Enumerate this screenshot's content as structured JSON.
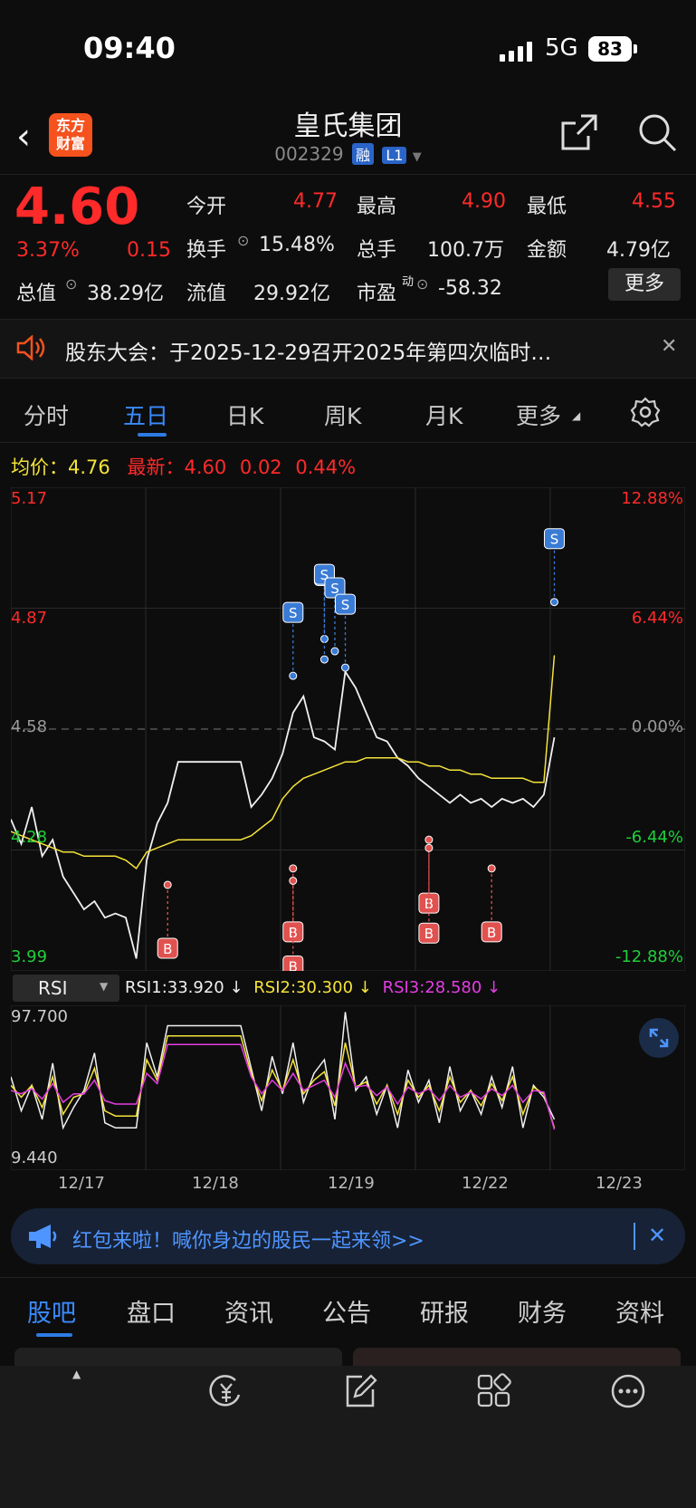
{
  "status_bar": {
    "time": "09:40",
    "network": "5G",
    "battery": "83"
  },
  "header": {
    "logo": "东方\n财富",
    "title": "皇氏集团",
    "code": "002329",
    "tags": [
      "融",
      "L1"
    ]
  },
  "quote": {
    "price": "4.60",
    "change_pct": "3.37%",
    "change_amt": "0.15",
    "fields": [
      {
        "label": "今开",
        "value": "4.77",
        "color": "red"
      },
      {
        "label": "最高",
        "value": "4.90",
        "color": "red"
      },
      {
        "label": "最低",
        "value": "4.55",
        "color": "red"
      },
      {
        "label": "换手",
        "value": "15.48%",
        "color": "white"
      },
      {
        "label": "总手",
        "value": "100.7万",
        "color": "white"
      },
      {
        "label": "金额",
        "value": "4.79亿",
        "color": "white"
      },
      {
        "label": "总值",
        "value": "38.29亿",
        "color": "white"
      },
      {
        "label": "流值",
        "value": "29.92亿",
        "color": "white"
      },
      {
        "label": "市盈",
        "value": "-58.32",
        "color": "white"
      }
    ],
    "pe_sup": "动",
    "more_label": "更多"
  },
  "notice": {
    "text": "股东大会：于2025-12-29召开2025年第四次临时…"
  },
  "period_tabs": [
    "分时",
    "五日",
    "日K",
    "周K",
    "月K",
    "更多"
  ],
  "active_period": "五日",
  "price_header": {
    "avg_label": "均价：",
    "avg_value": "4.76",
    "latest_label": "最新：",
    "latest_value": "4.60",
    "latest_change": "0.02",
    "latest_pct": "0.44%"
  },
  "chart_data": {
    "type": "line",
    "y_left_ticks": [
      "5.17",
      "4.87",
      "4.58",
      "4.28",
      "3.99"
    ],
    "y_right_ticks": [
      "12.88%",
      "6.44%",
      "0.00%",
      "-6.44%",
      "-12.88%"
    ],
    "ylim": [
      3.99,
      5.17
    ],
    "reference_price": 4.58,
    "x_labels": [
      "12/17",
      "12/18",
      "12/19",
      "12/22",
      "12/23"
    ],
    "series": [
      {
        "color": "#f0f0f0",
        "values": [
          4.36,
          4.3,
          4.39,
          4.27,
          4.31,
          4.22,
          4.18,
          4.14,
          4.16,
          4.12,
          4.13,
          4.12,
          4.02,
          4.26,
          4.35,
          4.4,
          4.5,
          4.5,
          4.5,
          4.5,
          4.5,
          4.5,
          4.5,
          4.39,
          4.42,
          4.46,
          4.52,
          4.62,
          4.66,
          4.56,
          4.55,
          4.53,
          4.72,
          4.68,
          4.62,
          4.56,
          4.55,
          4.51,
          4.49,
          4.46,
          4.44,
          4.42,
          4.4,
          4.42,
          4.4,
          4.41,
          4.39,
          4.41,
          4.4,
          4.41,
          4.39,
          4.42,
          4.56
        ]
      },
      {
        "color": "#f5e33a",
        "values": [
          4.33,
          4.32,
          4.31,
          4.3,
          4.29,
          4.28,
          4.28,
          4.27,
          4.27,
          4.27,
          4.27,
          4.26,
          4.24,
          4.28,
          4.29,
          4.3,
          4.31,
          4.31,
          4.31,
          4.31,
          4.31,
          4.31,
          4.31,
          4.32,
          4.34,
          4.36,
          4.41,
          4.44,
          4.46,
          4.47,
          4.48,
          4.49,
          4.5,
          4.5,
          4.51,
          4.51,
          4.51,
          4.51,
          4.5,
          4.5,
          4.49,
          4.49,
          4.48,
          4.48,
          4.47,
          4.47,
          4.46,
          4.46,
          4.46,
          4.46,
          4.45,
          4.45,
          4.76
        ]
      }
    ],
    "markers": [
      {
        "type": "S",
        "x_index": 27,
        "price": 4.71
      },
      {
        "type": "S",
        "x_index": 30,
        "price": 4.8
      },
      {
        "type": "S",
        "x_index": 30,
        "price": 4.75
      },
      {
        "type": "S",
        "x_index": 31,
        "price": 4.77
      },
      {
        "type": "S",
        "x_index": 32,
        "price": 4.73
      },
      {
        "type": "S",
        "x_index": 52,
        "price": 4.89
      },
      {
        "type": "B",
        "x_index": 15,
        "price": 4.2
      },
      {
        "type": "B",
        "x_index": 27,
        "price": 4.24
      },
      {
        "type": "B",
        "x_index": 27,
        "price": 4.21
      },
      {
        "type": "B",
        "x_index": 40,
        "price": 4.31
      },
      {
        "type": "B",
        "x_index": 40,
        "price": 4.29
      },
      {
        "type": "B",
        "x_index": 46,
        "price": 4.24
      }
    ]
  },
  "rsi": {
    "selector": "RSI",
    "rsi1_label": "RSI1:33.920 ↓",
    "rsi2_label": "RSI2:30.300 ↓",
    "rsi3_label": "RSI3:28.580 ↓",
    "top_tick": "97.700",
    "bottom_tick": "9.440",
    "ylim": [
      9.44,
      97.7
    ],
    "series": [
      {
        "name": "RSI1",
        "color": "#f0f0f0",
        "values": [
          60,
          40,
          55,
          35,
          68,
          30,
          42,
          52,
          74,
          33,
          30,
          30,
          30,
          80,
          60,
          90,
          90,
          90,
          90,
          90,
          90,
          90,
          90,
          65,
          40,
          72,
          50,
          80,
          45,
          62,
          70,
          35,
          98,
          52,
          60,
          38,
          55,
          30,
          64,
          45,
          58,
          33,
          66,
          40,
          52,
          38,
          60,
          42,
          66,
          30,
          55,
          48,
          35
        ]
      },
      {
        "name": "RSI2",
        "color": "#f5e33a",
        "values": [
          55,
          48,
          55,
          42,
          60,
          38,
          48,
          50,
          65,
          40,
          37,
          37,
          37,
          70,
          58,
          84,
          84,
          84,
          84,
          84,
          84,
          84,
          84,
          62,
          46,
          64,
          52,
          70,
          50,
          58,
          63,
          43,
          80,
          54,
          57,
          44,
          55,
          38,
          58,
          48,
          55,
          40,
          60,
          45,
          52,
          43,
          56,
          46,
          60,
          38,
          54,
          50,
          30
        ]
      },
      {
        "name": "RSI3",
        "color": "#e43de4",
        "values": [
          52,
          50,
          53,
          47,
          56,
          45,
          50,
          50,
          58,
          46,
          44,
          44,
          44,
          62,
          56,
          79,
          79,
          79,
          79,
          79,
          79,
          79,
          79,
          60,
          50,
          58,
          52,
          62,
          52,
          55,
          58,
          48,
          68,
          54,
          55,
          49,
          54,
          44,
          54,
          50,
          53,
          46,
          55,
          48,
          51,
          47,
          53,
          49,
          55,
          45,
          52,
          51,
          29
        ]
      }
    ]
  },
  "promo": {
    "text": "红包来啦！喊你身边的股民一起来领>>"
  },
  "bottom_tabs": [
    "股吧",
    "盘口",
    "资讯",
    "公告",
    "研报",
    "财务",
    "资料"
  ]
}
